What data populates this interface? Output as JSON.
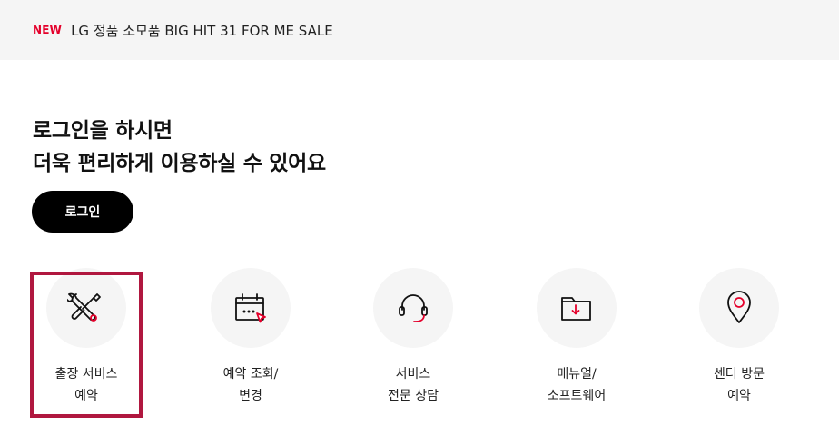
{
  "notice": {
    "badge": "NEW",
    "text": "LG 정품 소모품 BIG HIT 31 FOR ME SALE"
  },
  "greeting": {
    "line1": "로그인을 하시면",
    "line2": "더욱 편리하게 이용하실 수 있어요"
  },
  "login_button": {
    "label": "로그인"
  },
  "quick_menu": [
    {
      "icon": "wrench-screwdriver-icon",
      "line1": "출장 서비스",
      "line2": "예약",
      "highlighted": true
    },
    {
      "icon": "calendar-cursor-icon",
      "line1": "예약 조회/",
      "line2": "변경"
    },
    {
      "icon": "headset-icon",
      "line1": "서비스",
      "line2": "전문 상담"
    },
    {
      "icon": "folder-download-icon",
      "line1": "매뉴얼/",
      "line2": "소프트웨어"
    },
    {
      "icon": "location-pin-icon",
      "line1": "센터 방문",
      "line2": "예약"
    }
  ],
  "colors": {
    "accent": "#e4002b",
    "highlight_border": "#b0173f",
    "background_gray": "#f5f5f5",
    "button": "#000000"
  }
}
